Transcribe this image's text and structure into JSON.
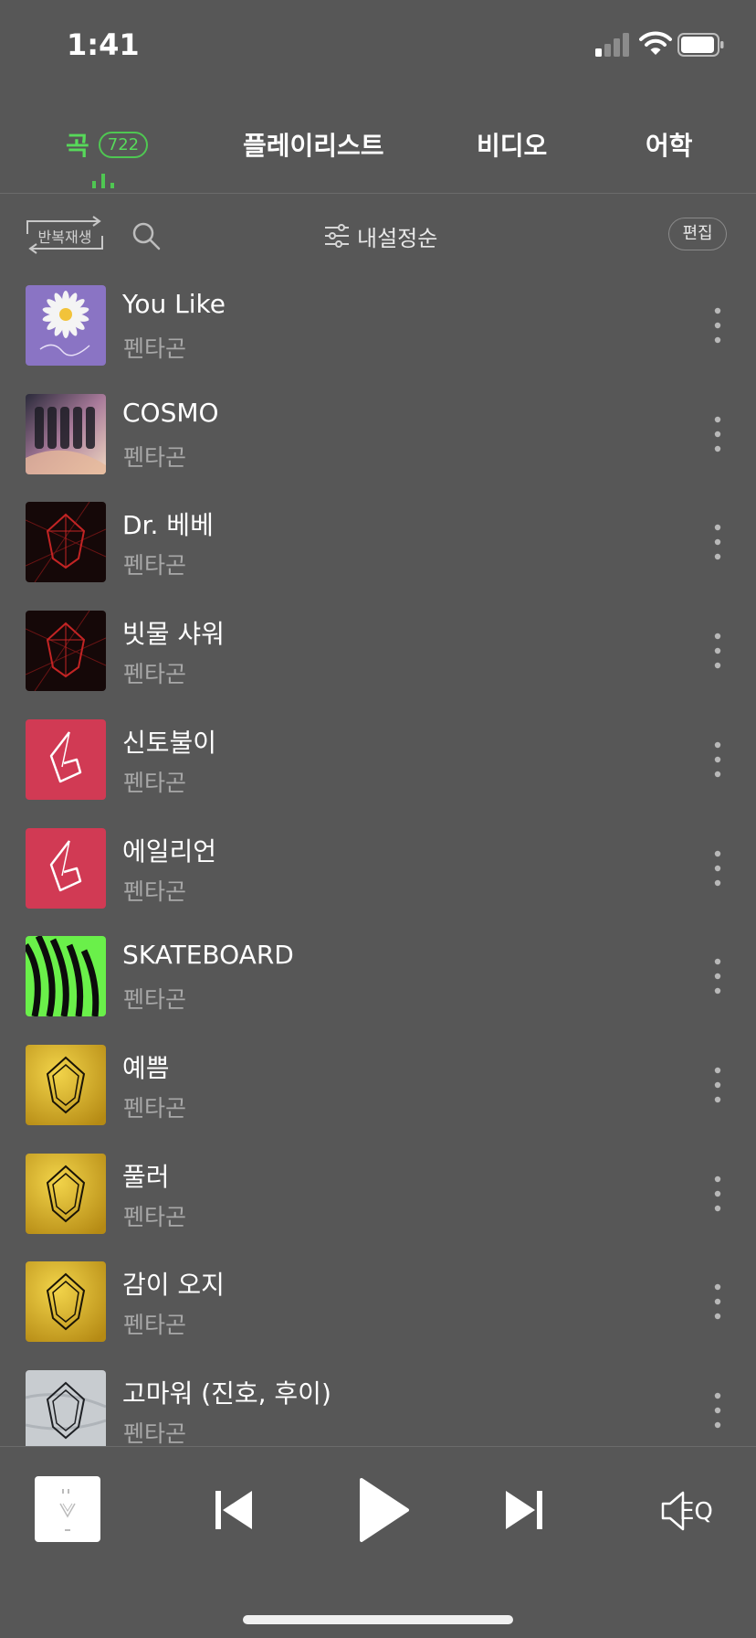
{
  "status_bar": {
    "time": "1:41"
  },
  "tabs": {
    "songs_label": "곡",
    "songs_count": "722",
    "playlist_label": "플레이리스트",
    "video_label": "비디오",
    "language_label": "어학"
  },
  "toolbar": {
    "repeat_label": "반복재생",
    "sort_label": "내설정순",
    "edit_label": "편집"
  },
  "songs": [
    {
      "title": "You Like",
      "artist": "펜타곤",
      "art": "daisy"
    },
    {
      "title": "COSMO",
      "artist": "펜타곤",
      "art": "cosmo"
    },
    {
      "title": "Dr. 베베",
      "artist": "펜타곤",
      "art": "dark-red"
    },
    {
      "title": "빗물 샤워",
      "artist": "펜타곤",
      "art": "dark-red"
    },
    {
      "title": "신토불이",
      "artist": "펜타곤",
      "art": "pink"
    },
    {
      "title": "에일리언",
      "artist": "펜타곤",
      "art": "pink"
    },
    {
      "title": "SKATEBOARD",
      "artist": "펜타곤",
      "art": "thumbs-up"
    },
    {
      "title": "예쁨",
      "artist": "펜타곤",
      "art": "gold"
    },
    {
      "title": "풀러",
      "artist": "펜타곤",
      "art": "gold"
    },
    {
      "title": "감이 오지",
      "artist": "펜타곤",
      "art": "gold"
    },
    {
      "title": "고마워 (진호, 후이)",
      "artist": "펜타곤",
      "art": "silver"
    }
  ],
  "player": {
    "eq_label": "EQ"
  },
  "colors": {
    "accent": "#57d95a",
    "background": "#575757",
    "secondary_text": "#a8a8a8"
  },
  "icons": [
    "signal-icon",
    "wifi-icon",
    "battery-icon",
    "search-icon",
    "sort-icon",
    "more-icon",
    "previous-icon",
    "play-icon",
    "next-icon",
    "eq-icon",
    "repeat-icon"
  ]
}
